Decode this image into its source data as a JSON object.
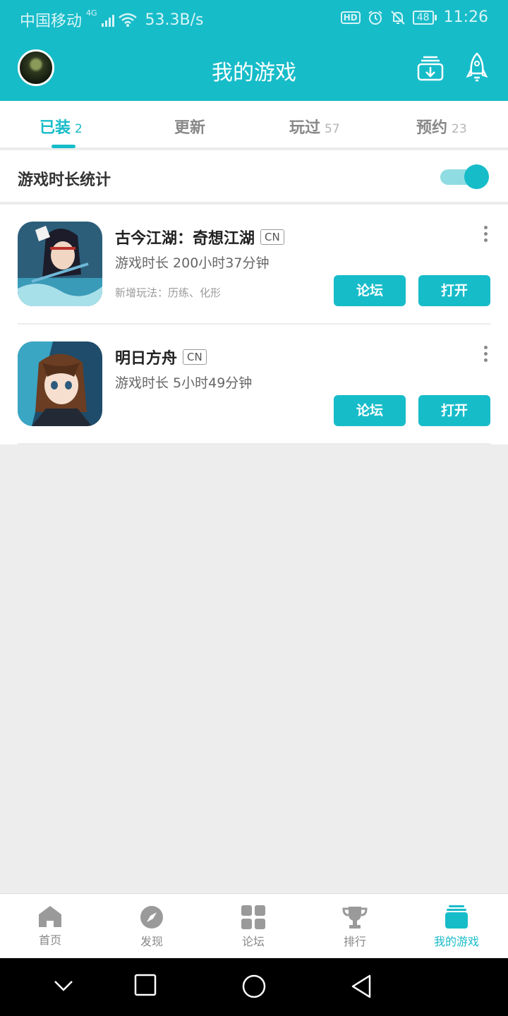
{
  "status_bar": {
    "carrier": "中国移动",
    "network": "4G",
    "speed": "53.3B/s",
    "hd_label": "HD",
    "battery": "48",
    "time": "11:26",
    "icons": [
      "signal-icon",
      "wifi-icon",
      "hd-icon",
      "alarm-icon",
      "mute-bell-icon",
      "battery-icon"
    ]
  },
  "app_bar": {
    "title": "我的游戏",
    "left_icon": "avatar",
    "right_icons": [
      "download-manager-icon",
      "rocket-icon"
    ]
  },
  "tabs": [
    {
      "label": "已装",
      "count": "2",
      "active": true
    },
    {
      "label": "更新",
      "count": "",
      "active": false
    },
    {
      "label": "玩过",
      "count": "57",
      "active": false
    },
    {
      "label": "预约",
      "count": "23",
      "active": false
    }
  ],
  "stats": {
    "label": "游戏时长统计",
    "toggle_on": true
  },
  "games": [
    {
      "name": "古今江湖：奇想江湖",
      "badge": "CN",
      "duration": "游戏时长 200小时37分钟",
      "extra": "新增玩法：历练、化形",
      "forum_label": "论坛",
      "open_label": "打开"
    },
    {
      "name": "明日方舟",
      "badge": "CN",
      "duration": "游戏时长 5小时49分钟",
      "extra": "",
      "forum_label": "论坛",
      "open_label": "打开"
    }
  ],
  "bottom_nav": [
    {
      "label": "首页",
      "icon": "home-icon",
      "active": false
    },
    {
      "label": "发现",
      "icon": "compass-icon",
      "active": false
    },
    {
      "label": "论坛",
      "icon": "grid-icon",
      "active": false
    },
    {
      "label": "排行",
      "icon": "trophy-icon",
      "active": false
    },
    {
      "label": "我的游戏",
      "icon": "my-games-icon",
      "active": true
    }
  ],
  "colors": {
    "accent": "#17bcc9",
    "background": "#ededed",
    "inactive": "#888888"
  }
}
